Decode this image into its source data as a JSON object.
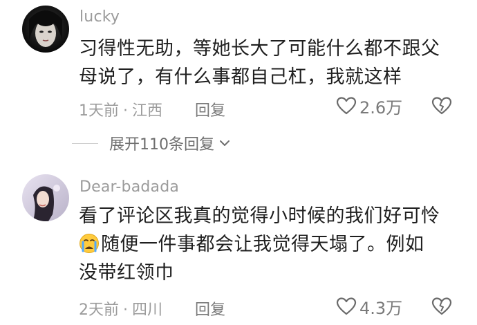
{
  "comments": [
    {
      "username": "lucky",
      "text_lines": [
        "习得性无助，等她长大了可能什么都不跟父",
        "母说了，有什么事都自己杠，我就这样"
      ],
      "time": "1天前",
      "dot": "·",
      "location": "江西",
      "reply_label": "回复",
      "likes": "2.6万",
      "icons": {
        "like": "heart-outline-icon",
        "dislike": "broken-heart-icon"
      }
    },
    {
      "username": "Dear-badada",
      "text_line1": "看了评论区我真的觉得小时候的我们好可怜",
      "emoji": "crying-face-emoji",
      "text_line2": "随便一件事都会让我觉得天塌了。例如",
      "text_line3": "没带红领巾",
      "time": "2天前",
      "dot": "·",
      "location": "四川",
      "reply_label": "回复",
      "likes": "4.3万",
      "icons": {
        "like": "heart-outline-icon",
        "dislike": "broken-heart-icon"
      }
    }
  ],
  "expand_replies": {
    "label": "展开110条回复",
    "icon": "chevron-down-icon"
  }
}
